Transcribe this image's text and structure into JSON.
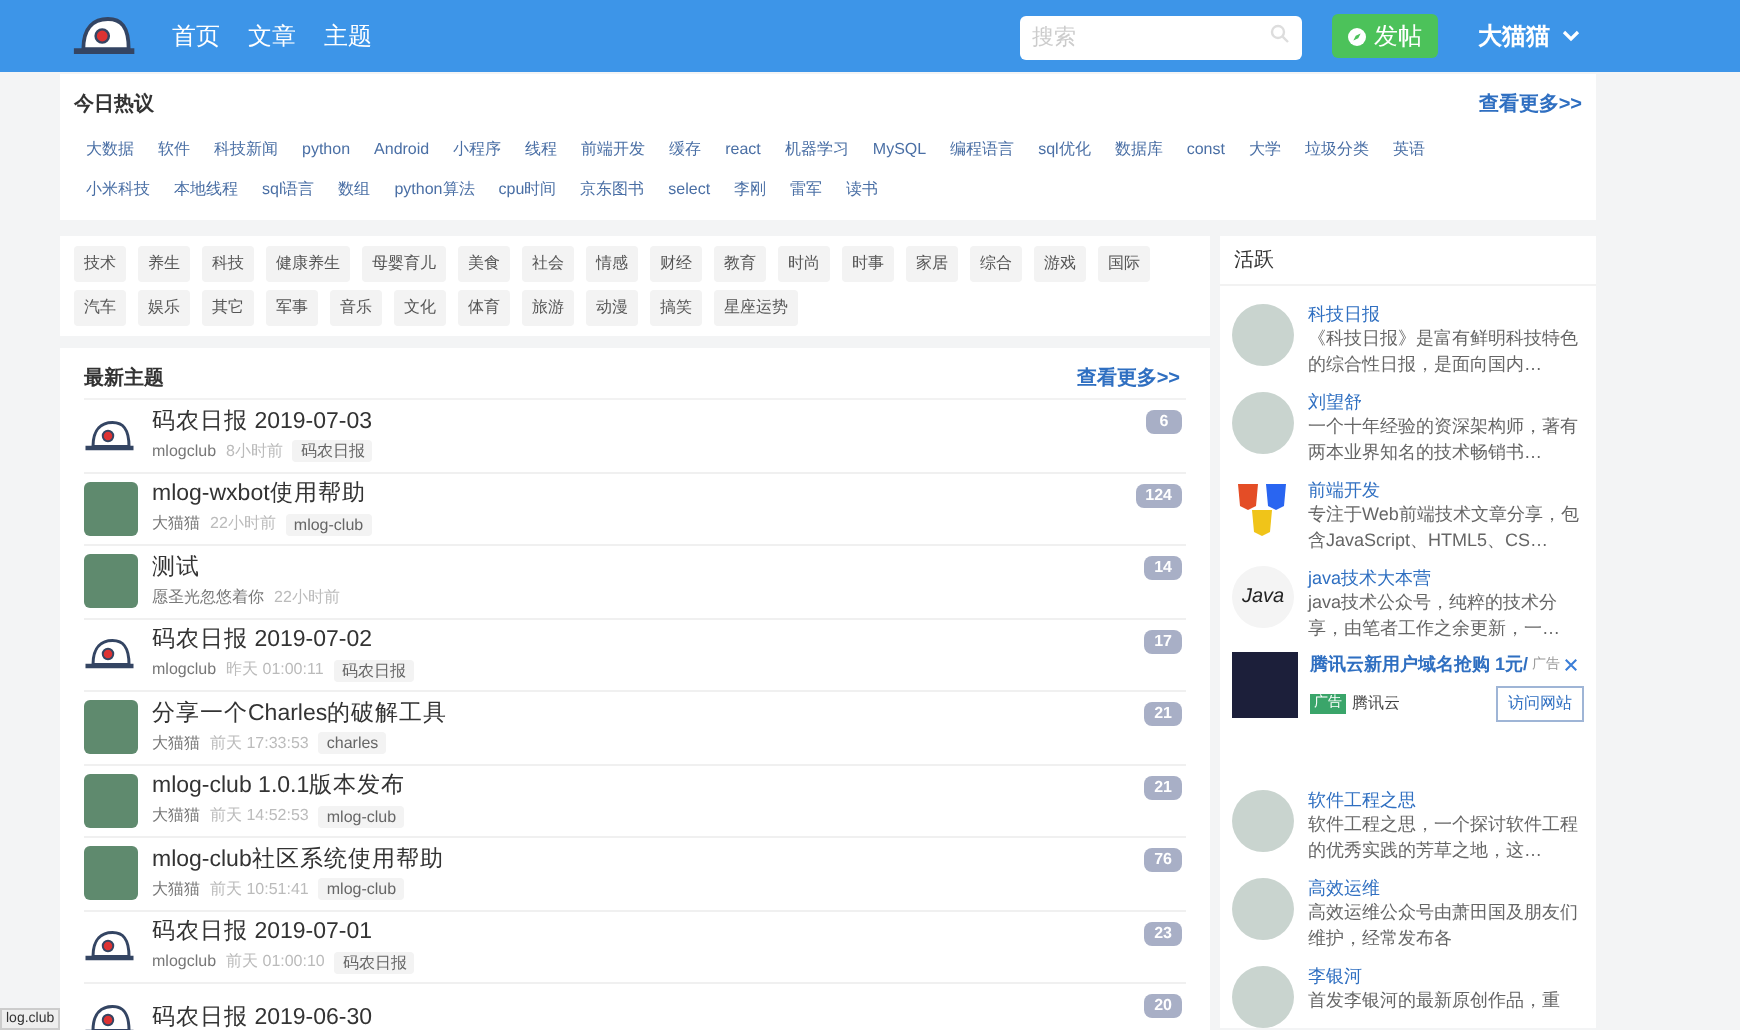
{
  "header": {
    "nav": [
      {
        "label": "首页",
        "selected": false
      },
      {
        "label": "文章",
        "selected": false
      },
      {
        "label": "主题",
        "selected": false
      }
    ],
    "search": {
      "placeholder": "搜索"
    },
    "post_button": "发帖",
    "user": "大猫猫"
  },
  "hot": {
    "title": "今日热议",
    "more": "查看更多>>",
    "tags": [
      "大数据",
      "软件",
      "科技新闻",
      "python",
      "Android",
      "小程序",
      "线程",
      "前端开发",
      "缓存",
      "react",
      "机器学习",
      "MySQL",
      "编程语言",
      "sql优化",
      "数据库",
      "const",
      "大学",
      "垃圾分类",
      "英语",
      "小米科技",
      "本地线程",
      "sql语言",
      "数组",
      "python算法",
      "cpu时间",
      "京东图书",
      "select",
      "李刚",
      "雷军",
      "读书"
    ]
  },
  "categories": [
    "技术",
    "养生",
    "科技",
    "健康养生",
    "母婴育儿",
    "美食",
    "社会",
    "情感",
    "财经",
    "教育",
    "时尚",
    "时事",
    "家居",
    "综合",
    "游戏",
    "国际",
    "汽车",
    "娱乐",
    "其它",
    "军事",
    "音乐",
    "文化",
    "体育",
    "旅游",
    "动漫",
    "搞笑",
    "星座运势"
  ],
  "latest": {
    "title": "最新主题",
    "more": "查看更多>>",
    "topics": [
      {
        "kind": "logo",
        "title": "码农日报 2019-07-03",
        "author": "mlogclub",
        "time": "8小时前",
        "tag": "码农日报",
        "count": "6"
      },
      {
        "kind": "photo",
        "title": "mlog-wxbot使用帮助",
        "author": "大猫猫",
        "time": "22小时前",
        "tag": "mlog-club",
        "count": "124"
      },
      {
        "kind": "photo",
        "title": "测试",
        "author": "愿圣光忽悠着你",
        "time": "22小时前",
        "count": "14"
      },
      {
        "kind": "logo",
        "title": "码农日报 2019-07-02",
        "author": "mlogclub",
        "time": "昨天 01:00:11",
        "tag": "码农日报",
        "count": "17"
      },
      {
        "kind": "photo",
        "title": "分享一个Charles的破解工具",
        "author": "大猫猫",
        "time": "前天 17:33:53",
        "tag": "charles",
        "count": "21"
      },
      {
        "kind": "photo",
        "title": "mlog-club 1.0.1版本发布",
        "author": "大猫猫",
        "time": "前天 14:52:53",
        "tag": "mlog-club",
        "count": "21"
      },
      {
        "kind": "photo",
        "title": "mlog-club社区系统使用帮助",
        "author": "大猫猫",
        "time": "前天 10:51:41",
        "tag": "mlog-club",
        "count": "76"
      },
      {
        "kind": "logo",
        "title": "码农日报 2019-07-01",
        "author": "mlogclub",
        "time": "前天 01:00:10",
        "tag": "码农日报",
        "count": "23"
      },
      {
        "kind": "logo",
        "title": "码农日报 2019-06-30",
        "count": "20"
      }
    ]
  },
  "active": {
    "title": "活跃",
    "items": [
      {
        "kind": "photo",
        "name": "科技日报",
        "desc": "《科技日报》是富有鲜明科技特色的综合性日报，是面向国内…"
      },
      {
        "kind": "photo",
        "name": "刘望舒",
        "desc": "一个十年经验的资深架构师，著有两本业界知名的技术畅销书…"
      },
      {
        "kind": "web",
        "name": "前端开发",
        "desc": "专注于Web前端技术文章分享，包含JavaScript、HTML5、CS…"
      },
      {
        "kind": "text",
        "avatar_label": "Java",
        "name": "java技术大本营",
        "desc": "java技术公众号，纯粹的技术分享，由笔者工作之余更新，一…"
      }
    ],
    "ad": {
      "title": "腾讯云新用户域名抢购 1元/",
      "mark": "广告",
      "badge": "广告",
      "brand": "腾讯云",
      "button": "访问网站"
    },
    "items2": [
      {
        "kind": "photo",
        "name": "软件工程之思",
        "desc": "软件工程之思，一个探讨软件工程的优秀实践的芳草之地，这…"
      },
      {
        "kind": "photo",
        "name": "高效运维",
        "desc": "高效运维公众号由萧田国及朋友们维护，经常发布各"
      },
      {
        "kind": "photo",
        "name": "李银河",
        "desc": "首发李银河的最新原创作品，重"
      }
    ]
  },
  "status_url": "log.club"
}
